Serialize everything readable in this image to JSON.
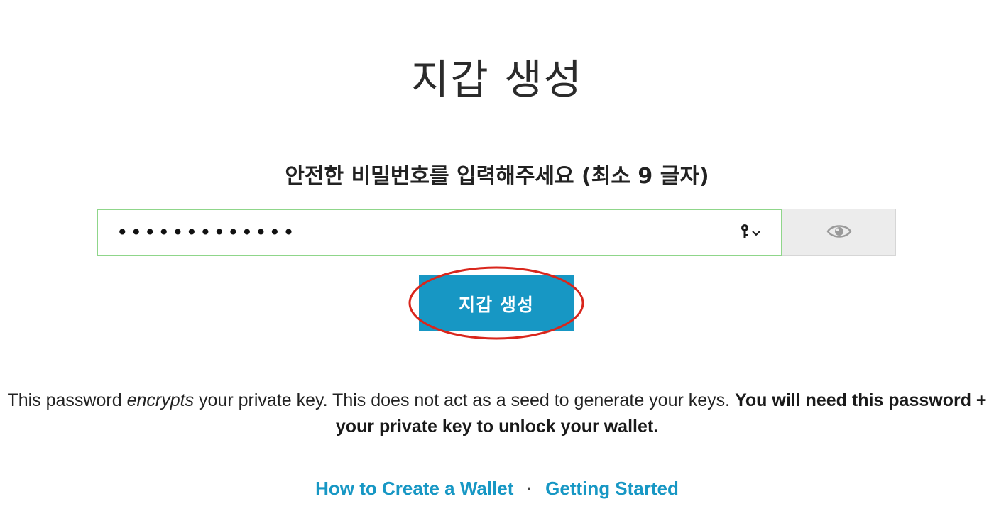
{
  "header": {
    "title": "지갑 생성"
  },
  "form": {
    "prompt": "안전한 비밀번호를 입력해주세요 (최소 9 글자)",
    "password_value": "•••••••••••••",
    "create_button_label": "지갑 생성"
  },
  "info": {
    "part1": "This password ",
    "part2_italic": "encrypts",
    "part3": " your private key. This does not act as a seed to generate your keys. ",
    "part4_bold": "You will need this password + your private key to unlock your wallet."
  },
  "links": {
    "how_to_create": "How to Create a Wallet",
    "separator": "·",
    "getting_started": "Getting Started"
  },
  "colors": {
    "accent": "#1797c4",
    "input_border": "#8fd68a",
    "highlight": "#d9261c"
  },
  "icons": {
    "autofill": "key-icon",
    "visibility": "eye-icon"
  }
}
